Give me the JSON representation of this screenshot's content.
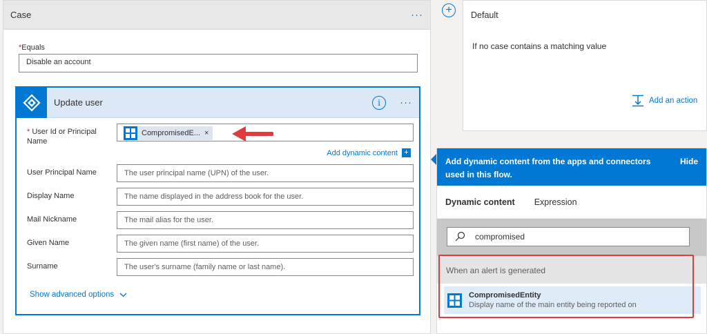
{
  "colors": {
    "accent": "#0078d4",
    "highlight": "#e03c3c"
  },
  "case": {
    "title": "Case",
    "more_label": "···",
    "equals_required": "*",
    "equals_label": "Equals",
    "equals_value": "Disable an account"
  },
  "update_user": {
    "title": "Update user",
    "info_label": "i",
    "more_label": "···",
    "required_mark": "*",
    "user_id_label_1": "User Id or Principal",
    "user_id_label_2": "Name",
    "token_label": "CompromisedE...",
    "token_remove": "×",
    "add_dynamic_content": "Add dynamic content",
    "add_dynamic_plus": "+",
    "fields": [
      {
        "label": "User Principal Name",
        "placeholder": "The user principal name (UPN) of the user."
      },
      {
        "label": "Display Name",
        "placeholder": "The name displayed in the address book for the user."
      },
      {
        "label": "Mail Nickname",
        "placeholder": "The mail alias for the user."
      },
      {
        "label": "Given Name",
        "placeholder": "The given name (first name) of the user."
      },
      {
        "label": "Surname",
        "placeholder": "The user's surname (family name or last name)."
      }
    ],
    "show_advanced": "Show advanced options"
  },
  "default": {
    "title": "Default",
    "description": "If no case contains a matching value",
    "add_action": "Add an action"
  },
  "dynamic_panel": {
    "header_line_1": "Add dynamic content from the apps and connectors",
    "header_line_2": "used in this flow.",
    "hide_label": "Hide",
    "tabs": [
      "Dynamic content",
      "Expression"
    ],
    "search_value": "compromised",
    "group_title": "When an alert is generated",
    "result_name": "CompromisedEntity",
    "result_description": "Display name of the main entity being reported on"
  }
}
